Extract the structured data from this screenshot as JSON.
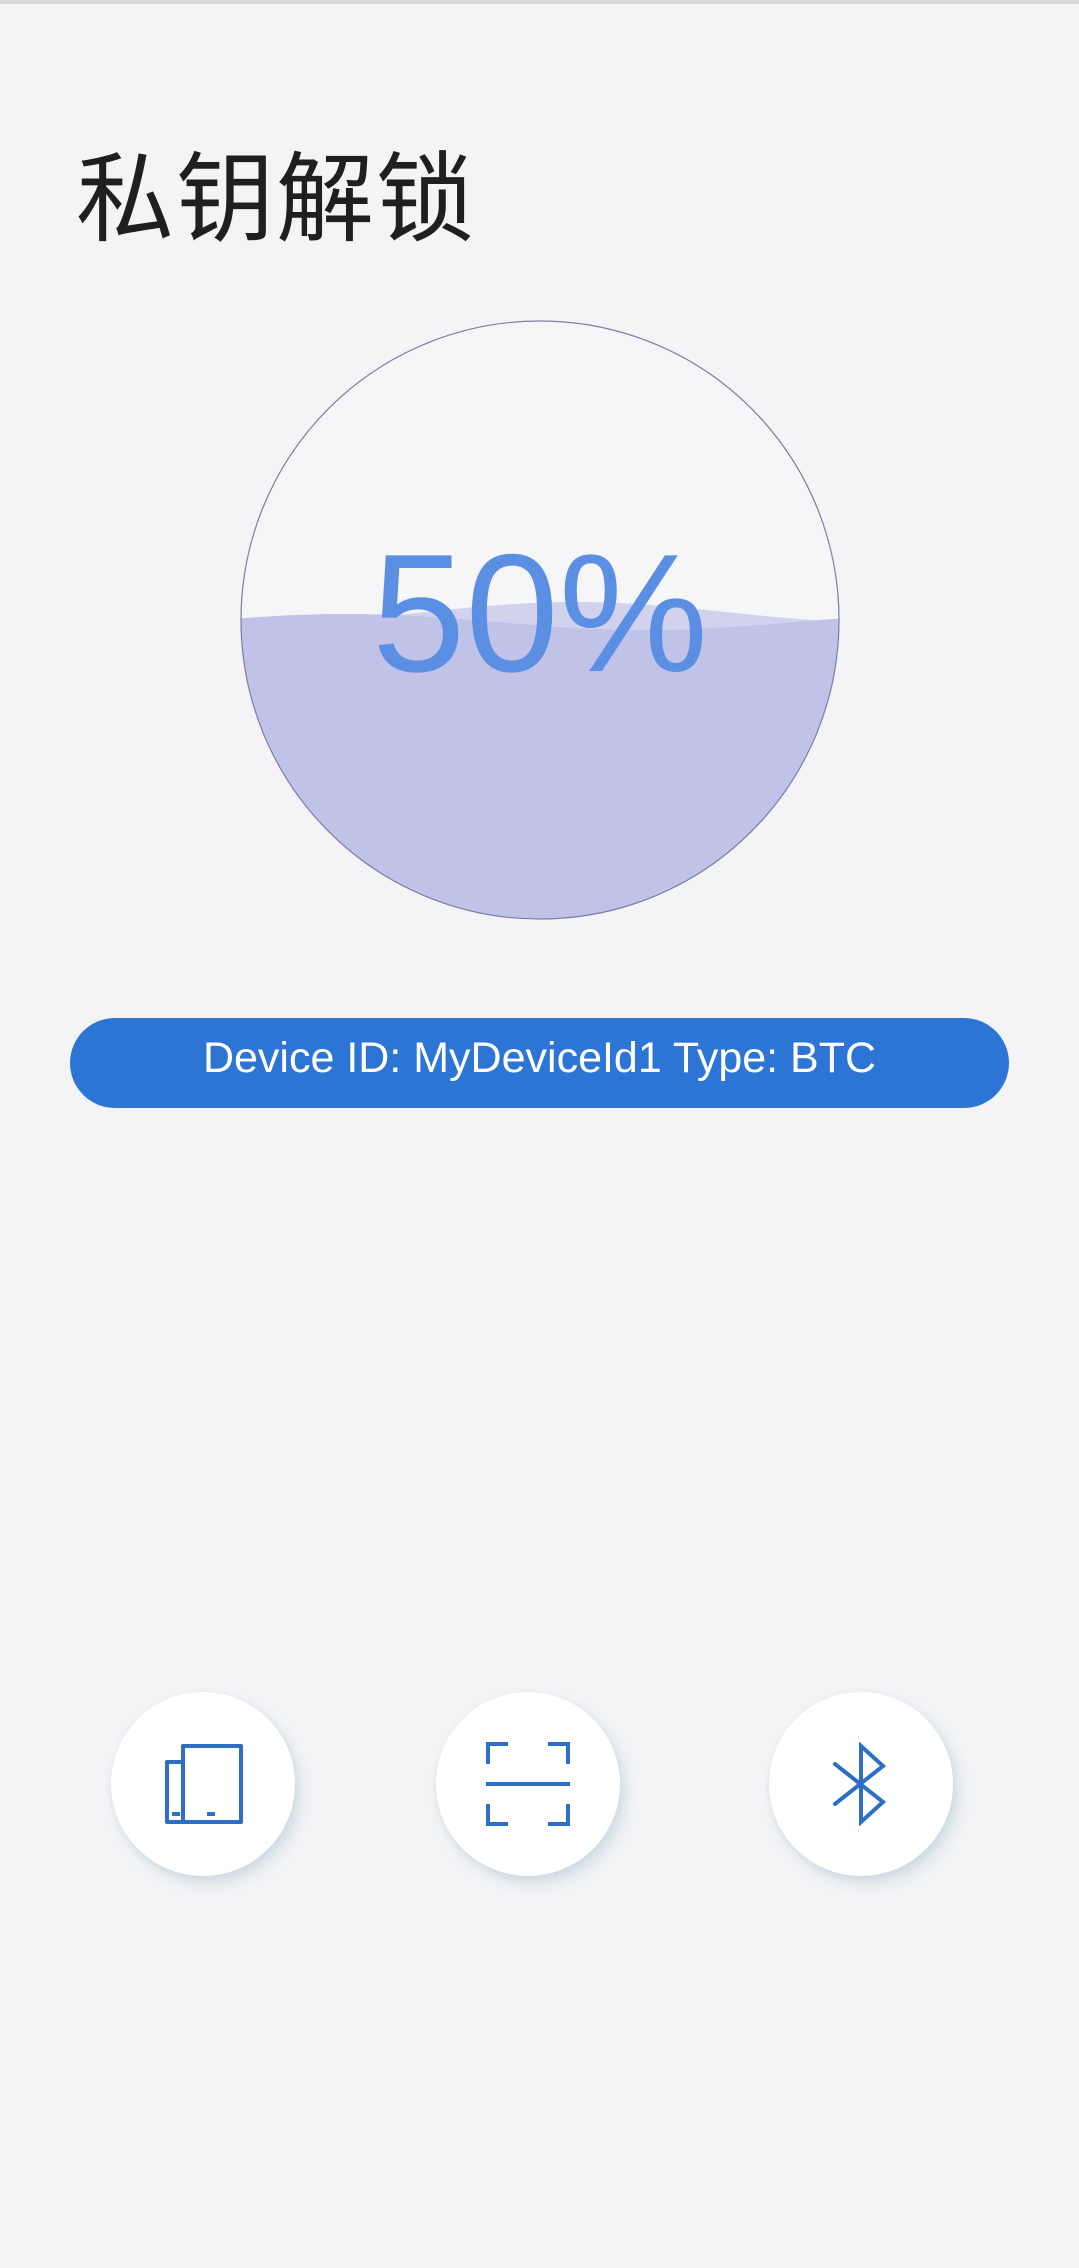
{
  "header": {
    "title": "私钥解锁"
  },
  "progress": {
    "percent": 0.5,
    "label": "50%"
  },
  "device_info": {
    "text": "Device ID: MyDeviceId1 Type: BTC"
  },
  "colors": {
    "background": "#f4f4f6",
    "accent": "#2d75d4",
    "progress_text": "#5b8fe3",
    "wave_fill": "#c0c2e8",
    "wave_back": "#d2d2ef"
  },
  "actions": [
    {
      "icon": "devices-icon"
    },
    {
      "icon": "scan-icon"
    },
    {
      "icon": "bluetooth-icon"
    }
  ]
}
